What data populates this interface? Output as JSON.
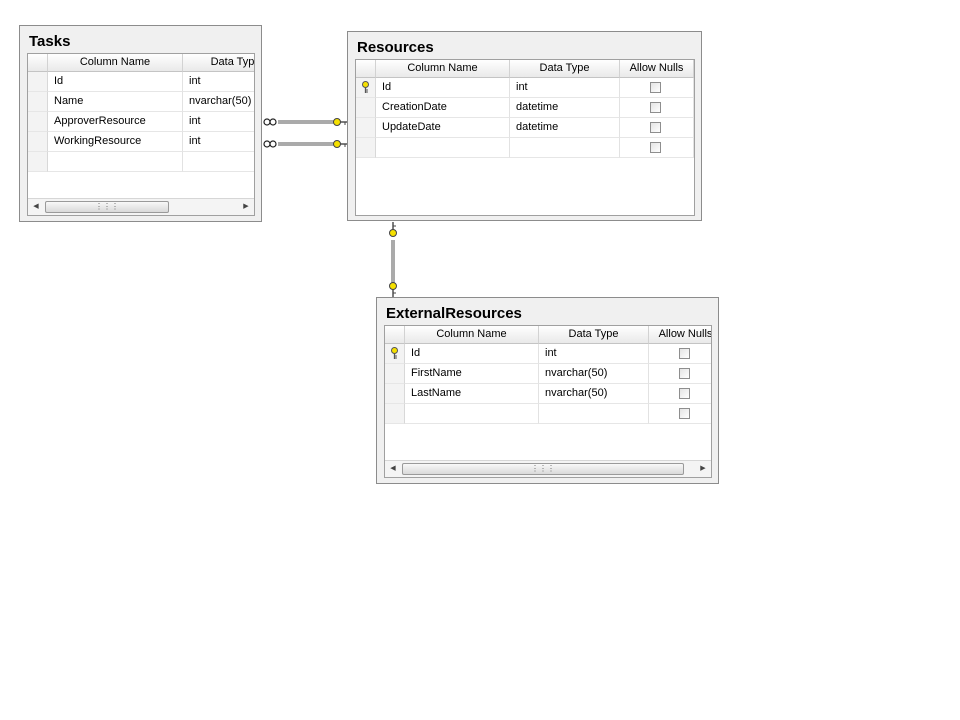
{
  "tables": {
    "tasks": {
      "title": "Tasks",
      "headers": [
        "Column Name",
        "Data Typ"
      ],
      "rows": [
        {
          "name": "Id",
          "type": "int"
        },
        {
          "name": "Name",
          "type": "nvarchar(50)"
        },
        {
          "name": "ApproverResource",
          "type": "int"
        },
        {
          "name": "WorkingResource",
          "type": "int"
        }
      ]
    },
    "resources": {
      "title": "Resources",
      "headers": [
        "Column Name",
        "Data Type",
        "Allow Nulls"
      ],
      "rows": [
        {
          "name": "Id",
          "type": "int"
        },
        {
          "name": "CreationDate",
          "type": "datetime"
        },
        {
          "name": "UpdateDate",
          "type": "datetime"
        }
      ]
    },
    "external_resources": {
      "title": "ExternalResources",
      "headers": [
        "Column Name",
        "Data Type",
        "Allow Nulls"
      ],
      "rows": [
        {
          "name": "Id",
          "type": "int"
        },
        {
          "name": "FirstName",
          "type": "nvarchar(50)"
        },
        {
          "name": "LastName",
          "type": "nvarchar(50)"
        }
      ]
    }
  },
  "icons": {
    "primary_key": "key-icon",
    "relationship_many": "infinity-icon",
    "relationship_one": "key-icon",
    "scroll_left": "arrow-left-icon",
    "scroll_right": "arrow-right-icon"
  },
  "colors": {
    "key": "#f5e000",
    "relationship_line": "#555555"
  }
}
